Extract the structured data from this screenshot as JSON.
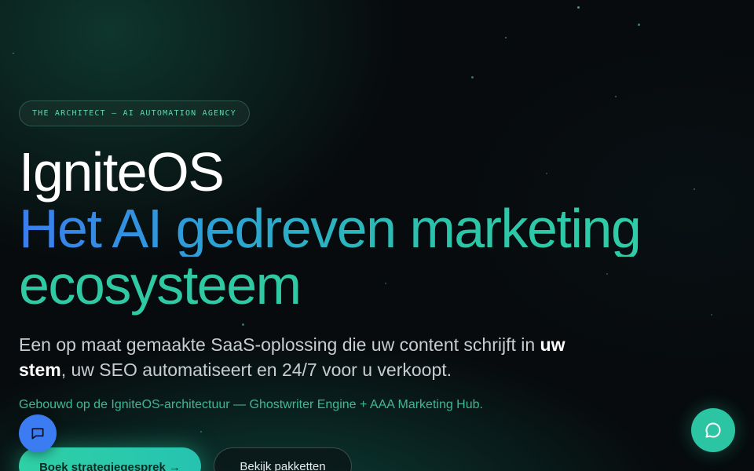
{
  "hero": {
    "badge": "THE ARCHITECT — AI AUTOMATION AGENCY",
    "title_line1": "IgniteOS",
    "title_line2": "Het AI gedreven marketing",
    "title_line3": "ecosysteem",
    "lead_part1": "Een op maat gemaakte SaaS-oplossing die uw content schrijft in ",
    "lead_bold": "uw stem",
    "lead_part2": ", uw SEO automatiseert en 24/7 voor u verkoopt.",
    "note": "Gebouwd op de IgniteOS-architectuur — Ghostwriter Engine + AAA Marketing Hub."
  },
  "buttons": {
    "primary": "Boek strategiegesprek →",
    "secondary": "Bekijk pakketten"
  },
  "widgets": {
    "left_chat_icon": "message-square-icon",
    "right_chat_icon": "chat-bubble-icon"
  },
  "colors": {
    "accent_teal": "#2fc9a4",
    "accent_blue": "#3b7cf2",
    "background": "#070b0d"
  }
}
